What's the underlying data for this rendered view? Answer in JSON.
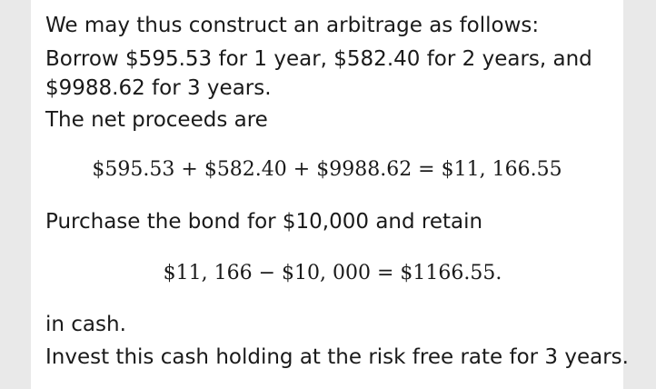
{
  "lines": {
    "l1": "We may thus construct an arbitrage as follows:",
    "l2": "Borrow $595.53 for 1 year, $582.40 for 2 years, and",
    "l3": "$9988.62 for 3 years.",
    "l4": "The net proceeds are",
    "eq1": "$595.53 + $582.40 + $9988.62 = $11, 166.55",
    "l5": "Purchase the bond for $10,000 and retain",
    "eq2": "$11, 166 − $10, 000 = $1166.55.",
    "l6": "in cash.",
    "l7": "Invest this cash holding at the risk free rate for 3 years."
  }
}
